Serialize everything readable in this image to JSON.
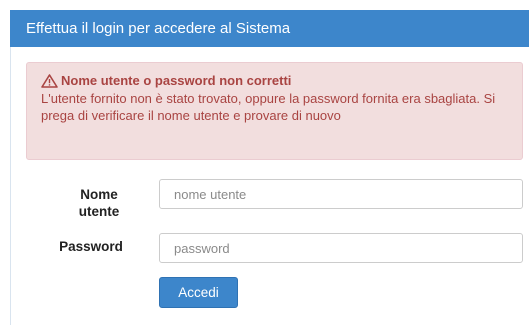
{
  "panel": {
    "title": "Effettua il login per accedere al Sistema"
  },
  "alert": {
    "icon": "warning-triangle-icon",
    "title": "Nome utente o password non corretti",
    "message": "L'utente fornito non è stato trovato, oppure la password fornita era sbagliata. Si prega di verificare il nome utente e provare di nuovo"
  },
  "form": {
    "username_label_line1": "Nome",
    "username_label_line2": "utente",
    "username_placeholder": "nome utente",
    "username_value": "",
    "password_label": "Password",
    "password_placeholder": "password",
    "password_value": "",
    "submit_label": "Accedi"
  },
  "colors": {
    "primary": "#3d86cb",
    "alert_bg": "#f2dede",
    "alert_text": "#a94442"
  }
}
